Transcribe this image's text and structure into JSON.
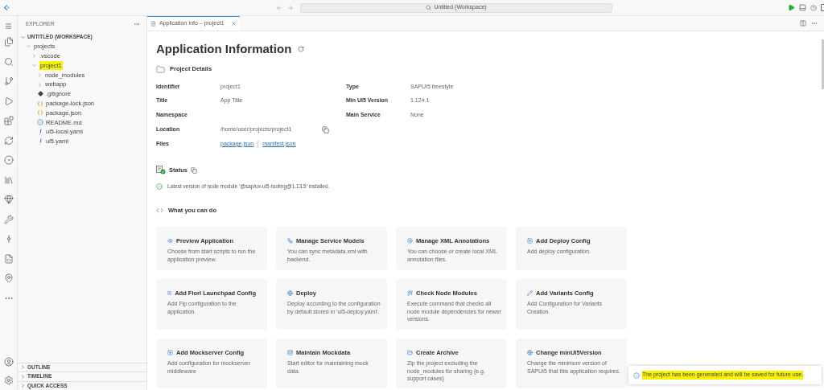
{
  "command_center": {
    "label": "Untitled (Workspace)"
  },
  "explorer": {
    "title": "EXPLORER",
    "workspace": {
      "label": "UNTITLED (WORKSPACE)",
      "expanded": true
    },
    "tree": [
      {
        "label": "projects",
        "kind": "folder",
        "expanded": true,
        "highlighted": false,
        "children": [
          {
            "label": ".vscode",
            "kind": "folder",
            "expanded": false,
            "highlighted": false
          },
          {
            "label": "project1",
            "kind": "folder",
            "expanded": true,
            "highlighted": true,
            "children": [
              {
                "label": "node_modules",
                "kind": "folder",
                "expanded": false,
                "highlighted": false
              },
              {
                "label": "webapp",
                "kind": "folder",
                "expanded": false,
                "highlighted": false
              },
              {
                "label": ".gitignore",
                "kind": "git",
                "highlighted": false
              },
              {
                "label": "package-lock.json",
                "kind": "json",
                "highlighted": false
              },
              {
                "label": "package.json",
                "kind": "json",
                "highlighted": false
              },
              {
                "label": "README.md",
                "kind": "info",
                "highlighted": false
              },
              {
                "label": "ui5-local.yaml",
                "kind": "yaml",
                "highlighted": false
              },
              {
                "label": "ui5.yaml",
                "kind": "yaml",
                "highlighted": false
              }
            ]
          }
        ]
      }
    ],
    "sections": [
      {
        "label": "OUTLINE",
        "expanded": false
      },
      {
        "label": "TIMELINE",
        "expanded": false
      },
      {
        "label": "QUICK ACCESS",
        "expanded": false
      }
    ]
  },
  "tab": {
    "label": "Application Info – project1",
    "selected": true
  },
  "page": {
    "title": "Application Information",
    "details_heading": "Project Details",
    "details_left": [
      {
        "label": "Identifier",
        "value": "project1"
      },
      {
        "label": "Title",
        "value": "App Title"
      },
      {
        "label": "Namespace"
      },
      {
        "label": "Location",
        "value": "/home/user/projects/project1",
        "copy": true
      },
      {
        "label": "Files",
        "links": [
          "package.json",
          "manifest.json"
        ]
      }
    ],
    "details_right": [
      {
        "label": "Type",
        "value": "SAPUI5 freestyle"
      },
      {
        "label": "Min UI5 Version",
        "value": "1.124.1"
      },
      {
        "label": "Main Service",
        "value": "None"
      }
    ],
    "status_heading": "Status",
    "status_message": "Latest version of node module '@sap/ux-ui5-tooling@1.13.5' installed.",
    "actions_heading": "What you can do",
    "actions": [
      {
        "title": "Preview Application",
        "description": "Choose from start scripts to run the application preview."
      },
      {
        "title": "Manage Service Models",
        "description": "You can sync metadata.xml with backend."
      },
      {
        "title": "Manage XML Annotations",
        "description": "You can choose or create local XML annotation files."
      },
      {
        "title": "Add Deploy Config",
        "description": "Add deploy configuration."
      },
      {
        "title": "Add Fiori Launchpad Config",
        "description": "Add Flp configuration to the application."
      },
      {
        "title": "Deploy",
        "description": "Deploy according to the configuration by default stored in 'ui5-deploy.yaml'."
      },
      {
        "title": "Check Node Modules",
        "description": "Execute command that checks all node module dependencies for newer versions."
      },
      {
        "title": "Add Variants Config",
        "description": "Add Configuration for Variants Creation."
      },
      {
        "title": "Add Mockserver Config",
        "description": "Add configuration for mockserver middleware"
      },
      {
        "title": "Maintain Mockdata",
        "description": "Start editor for maintaining mock data."
      },
      {
        "title": "Create Archive",
        "description": "Zip the project excluding the node_modules for sharing (e.g. support cases)"
      },
      {
        "title": "Change minUI5Version",
        "description": "Change the minimum version of SAPUI5 that this application requires."
      }
    ]
  },
  "notification": {
    "message": "The project has been generated and will be saved for future use.",
    "highlighted": true
  }
}
